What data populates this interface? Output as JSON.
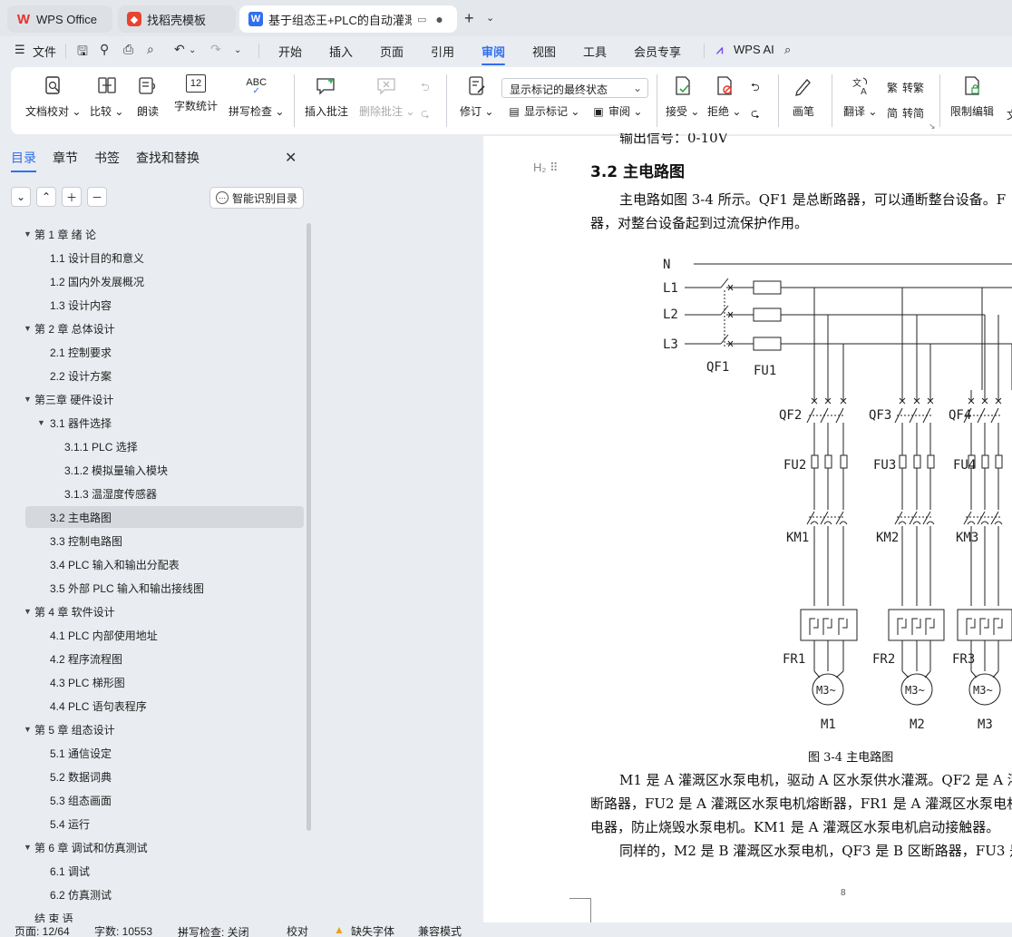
{
  "tabs": {
    "wps": "WPS Office",
    "daoke": "找稻壳模板",
    "doc": "基于组态王+PLC的自动灌溉控",
    "new": "+"
  },
  "menu": {
    "file": "文件",
    "items": [
      "开始",
      "插入",
      "页面",
      "引用",
      "审阅",
      "视图",
      "工具",
      "会员专享"
    ],
    "active": "审阅",
    "ai": "WPS AI"
  },
  "ribbon": {
    "doc_check": "文档校对",
    "compare": "比较",
    "read": "朗读",
    "word_count": "字数统计",
    "spell_check": "拼写检查",
    "insert_comment": "插入批注",
    "delete_comment": "删除批注",
    "revise": "修订",
    "markup_state": "显示标记的最终状态",
    "show_markup": "显示标记",
    "review": "审阅",
    "accept": "接受",
    "reject": "拒绝",
    "pen": "画笔",
    "translate": "翻译",
    "to_trad": "转繁",
    "to_simp": "转简",
    "restrict": "限制编辑",
    "word_count_icon_text": "12",
    "spell_icon_text": "ABC"
  },
  "sidebar": {
    "tabs": [
      "目录",
      "章节",
      "书签",
      "查找和替换"
    ],
    "smart": "智能识别目录",
    "toc": [
      {
        "label": "第 1 章  绪  论",
        "level": 1,
        "arrow": true
      },
      {
        "label": "1.1  设计目的和意义",
        "level": 2
      },
      {
        "label": "1.2  国内外发展概况",
        "level": 2
      },
      {
        "label": "1.3  设计内容",
        "level": 2
      },
      {
        "label": "第 2 章  总体设计",
        "level": 1,
        "arrow": true
      },
      {
        "label": "2.1  控制要求",
        "level": 2
      },
      {
        "label": "2.2    设计方案",
        "level": 2
      },
      {
        "label": "第三章  硬件设计",
        "level": 1,
        "arrow": true
      },
      {
        "label": "3.1 器件选择",
        "level": 2,
        "arrow": true
      },
      {
        "label": "3.1.1 PLC 选择",
        "level": 3
      },
      {
        "label": "3.1.2  模拟量输入模块",
        "level": 3
      },
      {
        "label": "3.1.3  温湿度传感器",
        "level": 3
      },
      {
        "label": "3.2 主电路图",
        "level": 2,
        "selected": true
      },
      {
        "label": "3.3 控制电路图",
        "level": 2
      },
      {
        "label": "3.4 PLC 输入和输出分配表",
        "level": 2
      },
      {
        "label": "3.5  外部 PLC 输入和输出接线图",
        "level": 2
      },
      {
        "label": "第 4 章  软件设计",
        "level": 1,
        "arrow": true
      },
      {
        "label": "4.1 PLC 内部使用地址",
        "level": 2
      },
      {
        "label": "4.2  程序流程图",
        "level": 2
      },
      {
        "label": "4.3  PLC 梯形图",
        "level": 2
      },
      {
        "label": "4.4 PLC 语句表程序",
        "level": 2
      },
      {
        "label": "第 5 章  组态设计",
        "level": 1,
        "arrow": true
      },
      {
        "label": "5.1  通信设定",
        "level": 2
      },
      {
        "label": "5.2 数据词典",
        "level": 2
      },
      {
        "label": "5.3 组态画面",
        "level": 2
      },
      {
        "label": "5.4 运行",
        "level": 2
      },
      {
        "label": "第 6 章  调试和仿真测试",
        "level": 1,
        "arrow": true
      },
      {
        "label": "6.1  调试",
        "level": 2
      },
      {
        "label": "6.2  仿真测试",
        "level": 2
      },
      {
        "label": "结  束  语",
        "level": 1
      }
    ]
  },
  "document": {
    "top_partial": "输出信号：0-10V",
    "heading": "3.2 主电路图",
    "heading_marker": "H₂",
    "para1_l1": "主电路如图 3-4 所示。QF1 是总断路器，可以通断整台设备。F",
    "para1_l2": "器，对整台设备起到过流保护作用。",
    "caption": "图 3-4  主电路图",
    "para2_l1": "M1 是 A 灌溉区水泵电机，驱动 A 区水泵供水灌溉。QF2 是 A 灌溉",
    "para2_l2": "断路器，FU2 是 A 灌溉区水泵电机熔断器，FR1 是 A 灌溉区水泵电机",
    "para2_l3": "电器，防止烧毁水泵电机。KM1 是 A 灌溉区水泵电机启动接触器。",
    "para3_l1": "同样的，M2 是 B 灌溉区水泵电机，QF3 是 B 区断路器，FU3 是",
    "page_number": "8"
  },
  "circuit": {
    "lines": [
      "N",
      "L1",
      "L2",
      "L3"
    ],
    "qf1": "QF1",
    "fu1": "FU1",
    "branches": [
      {
        "qf": "QF2",
        "fu": "FU2",
        "km": "KM1",
        "fr": "FR1",
        "motor": "M1",
        "motor_label": "M3~"
      },
      {
        "qf": "QF3",
        "fu": "FU3",
        "km": "KM2",
        "fr": "FR2",
        "motor": "M2",
        "motor_label": "M3~"
      },
      {
        "qf": "QF4",
        "fu": "FU4",
        "km": "KM3",
        "fr": "FR3",
        "motor": "M3",
        "motor_label": "M3~"
      }
    ]
  },
  "status": {
    "page": "页面: 12/64",
    "words": "字数: 10553",
    "spell": "拼写检查: 关闭",
    "proof": "校对",
    "missing_font": "缺失字体",
    "compat": "兼容模式"
  },
  "colors": {
    "accent": "#2f6ff0",
    "wps_red": "#e8332a"
  }
}
